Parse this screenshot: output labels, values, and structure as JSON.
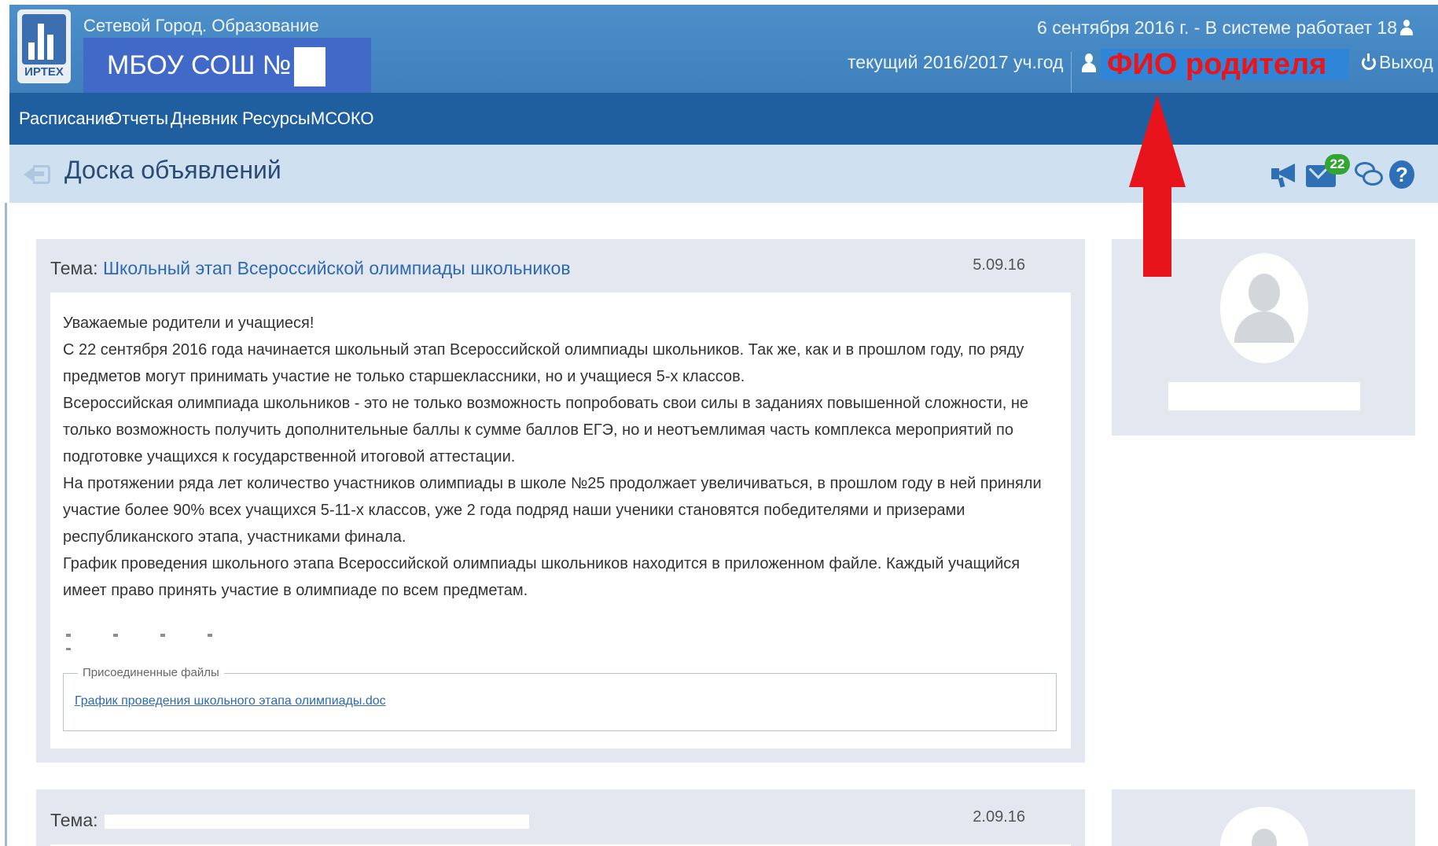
{
  "header": {
    "logo_text": "ИРТЕХ",
    "app_title": "Сетевой Город. Образование",
    "school_name": "МБОУ СОШ №",
    "date_status": "6 сентября 2016 г. - В системе работает 18",
    "school_year": "текущий 2016/2017 уч.год",
    "user_name": "ФИО родителя",
    "logout_label": "Выход"
  },
  "nav": {
    "items": [
      {
        "label": "Расписание"
      },
      {
        "label": "Отчеты"
      },
      {
        "label": "Дневник"
      },
      {
        "label": "Ресурсы"
      },
      {
        "label": "МСОКО"
      }
    ]
  },
  "titlebar": {
    "title": "Доска объявлений",
    "mail_count": "22",
    "icons": [
      "back-icon",
      "megaphone-icon",
      "mail-icon",
      "chat-icon",
      "help-icon"
    ]
  },
  "posts": [
    {
      "topic_label": "Тема:",
      "topic_title": "Школьный этап Всероссийской олимпиады школьников",
      "date": "5.09.16",
      "paragraphs": [
        "Уважаемые родители и учащиеся!",
        "С 22 сентября 2016 года начинается школьный этап Всероссийской олимпиады школьников. Так же, как и в прошлом году, по ряду предметов могут принимать участие не только старшеклассники, но и учащиеся 5-х классов.",
        "Всероссийская олимпиада школьников - это не только возможность попробовать свои силы в заданиях повышенной сложности, не только возможность получить дополнительные баллы к сумме баллов ЕГЭ, но и неотъемлимая часть комплекса мероприятий по подготовке учащихся к государственной итоговой аттестации.",
        "На протяжении ряда лет количество участников олимпиады в школе №25 продолжает увеличиваться, в прошлом году в ней приняли участие более 90% всех учащихся 5-11-х классов, уже 2 года подряд наши ученики становятся победителями и призерами республиканского этапа, участниками финала.",
        "График проведения школьного этапа Всероссийской олимпиады школьников находится в приложенном файле. Каждый учащийся имеет право принять участие в олимпиаде по всем предметам."
      ],
      "files_legend": "Присоединенные файлы",
      "file_name": "График проведения школьного этапа олимпиады.doc"
    },
    {
      "topic_label": "Тема:",
      "date": "2.09.16"
    }
  ],
  "colors": {
    "header_bg": "#4c8fc9",
    "nav_bg": "#1f5fa0",
    "titlebar_bg": "#cfe0f1",
    "user_name_color": "#e8151b",
    "badge_green": "#33a532",
    "annotation_red": "#e8141c"
  }
}
